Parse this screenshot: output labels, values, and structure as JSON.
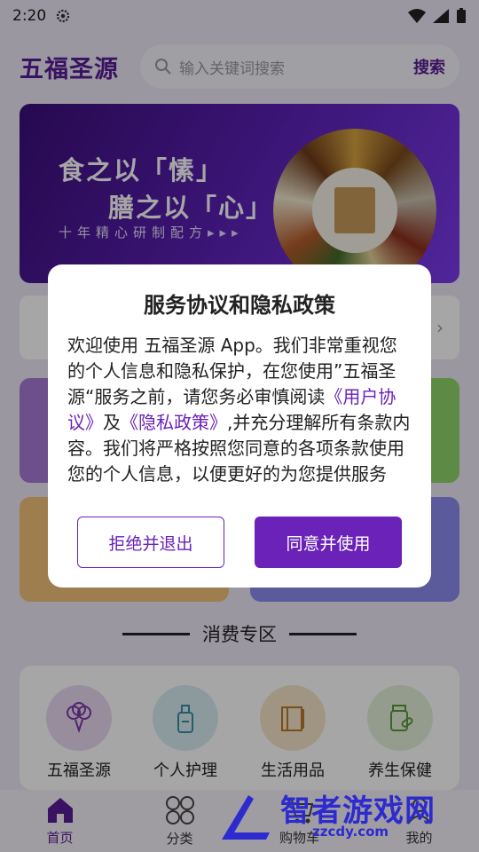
{
  "status_bar": {
    "time": "2:20"
  },
  "header": {
    "logo": "五福圣源",
    "search_placeholder": "输入关键词搜索",
    "search_button": "搜索"
  },
  "banner": {
    "line1": "食之以「愫」",
    "line2": "膳之以「心」",
    "subtitle": "十年精心研制配方▸▸▸"
  },
  "section": {
    "title": "消费专区"
  },
  "categories": [
    {
      "label": "五福圣源",
      "icon": "broccoli-icon",
      "color": "#ead9f2"
    },
    {
      "label": "个人护理",
      "icon": "lotion-bottle-icon",
      "color": "#d7edf3"
    },
    {
      "label": "生活用品",
      "icon": "book-icon",
      "color": "#f6e5c8"
    },
    {
      "label": "养生保健",
      "icon": "pill-jar-icon",
      "color": "#e4f0da"
    }
  ],
  "tabs": [
    {
      "label": "首页",
      "icon": "home-icon"
    },
    {
      "label": "分类",
      "icon": "grid-icon"
    },
    {
      "label": "购物车",
      "icon": "cart-icon"
    },
    {
      "label": "我的",
      "icon": "user-icon"
    }
  ],
  "dialog": {
    "title": "服务协议和隐私政策",
    "body_part1": "欢迎使用 五福圣源 App。我们非常重视您的个人信息和隐私保护，在您使用”五福圣源“服务之前，请您务必审慎阅读",
    "link_user_agreement": "《用户协议》",
    "body_and": "及",
    "link_privacy_policy": "《隐私政策》",
    "body_part2": ",并充分理解所有条款内容。我们将严格按照您同意的各项条款使用您的个人信息，以便更好的为您提供服务",
    "reject_button": "拒绝并退出",
    "agree_button": "同意并使用"
  },
  "watermark": {
    "text": "智者游戏网",
    "url": "zzcdy.com"
  },
  "colors": {
    "brand": "#5a1c97",
    "accent": "#6a22b8"
  }
}
